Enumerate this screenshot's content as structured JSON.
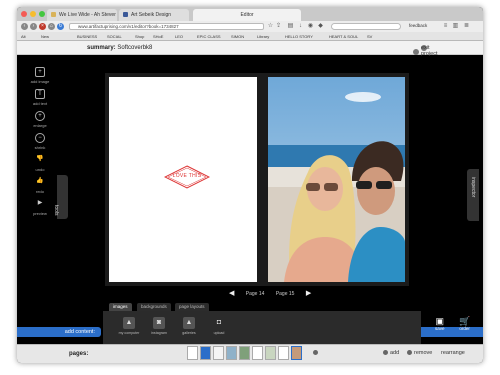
{
  "browser": {
    "tabs": [
      {
        "label": "We Live Wide - Ah Stever",
        "favicon_color": "#d9b35a"
      },
      {
        "label": "Art Sebeik Design",
        "favicon_color": "#3b5998"
      }
    ],
    "window_title": "Editor",
    "url": "www.artifactuprising.com/v1/editor?book=1734827",
    "bookmarks": [
      "Alt",
      "New",
      "BUSINESS",
      "SOCIAL",
      "Shop",
      "SHoE",
      "LEO",
      "EPIC CLASS",
      "SIMON",
      "Library",
      "HELLO STORY",
      "HEART & SOUL",
      "SV"
    ],
    "feedback_label": "feedback"
  },
  "header": {
    "summary_label": "summary:",
    "project_name": "Softcoverbk8",
    "exit_label": "exit project"
  },
  "tools": [
    {
      "label": "add image",
      "icon": "add-image-icon"
    },
    {
      "label": "add text",
      "icon": "add-text-icon"
    },
    {
      "label": "enlarge",
      "icon": "zoom-in-icon"
    },
    {
      "label": "shrink",
      "icon": "zoom-out-icon"
    },
    {
      "label": "undo",
      "icon": "undo-icon"
    },
    {
      "label": "redo",
      "icon": "redo-icon"
    },
    {
      "label": "preview",
      "icon": "play-icon"
    }
  ],
  "tools_tab": "tools",
  "inspector_tab": "inspector",
  "book": {
    "left_graphic_text": "LOVE THIS"
  },
  "pager": {
    "left_page": "Page 14",
    "right_page": "Page 15"
  },
  "panel": {
    "tabs": [
      "images",
      "backgrounds",
      "page layouts"
    ],
    "sources": [
      {
        "label": "my computer",
        "icon": "computer-upload-icon"
      },
      {
        "label": "instagram",
        "icon": "instagram-icon"
      },
      {
        "label": "galleries",
        "icon": "gallery-icon"
      },
      {
        "label": "upload",
        "icon": "camera-icon"
      }
    ]
  },
  "add_content_label": "add content:",
  "dock": {
    "save_label": "save",
    "order_label": "order"
  },
  "pages_strip": {
    "label": "pages:",
    "add_label": "add",
    "remove_label": "remove",
    "rearrange_label": "rearrange"
  }
}
